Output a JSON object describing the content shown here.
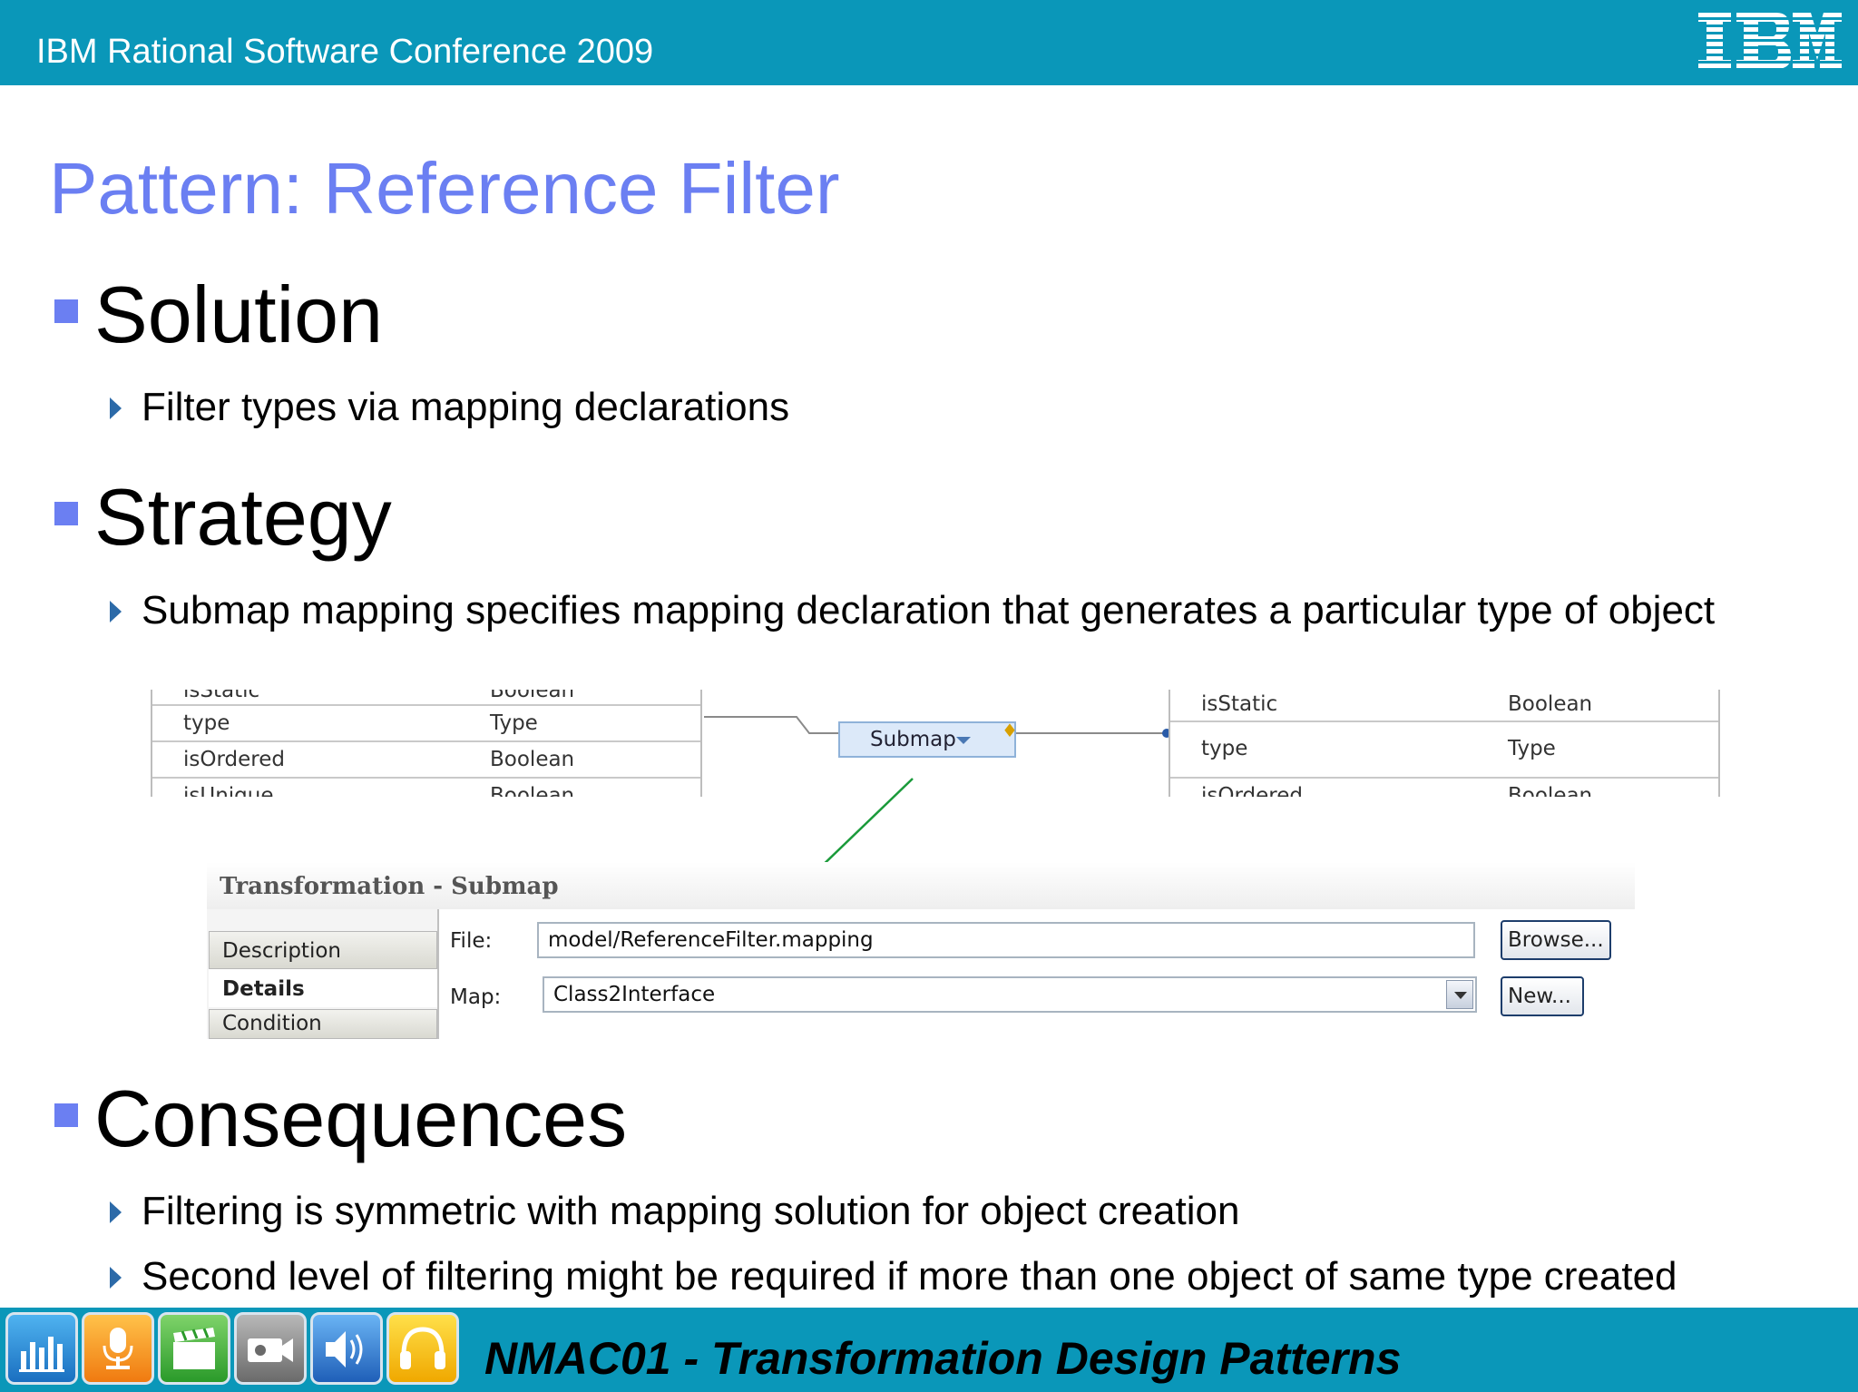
{
  "header": {
    "conference": "IBM Rational Software Conference 2009",
    "logo_text": "IBM"
  },
  "slide": {
    "title": "Pattern: Reference Filter",
    "sections": [
      {
        "heading": "Solution",
        "points": [
          "Filter types via mapping declarations"
        ]
      },
      {
        "heading": "Strategy",
        "points": [
          "Submap mapping specifies mapping declaration that generates a particular type of object"
        ]
      },
      {
        "heading": "Consequences",
        "points": [
          "Filtering is symmetric with mapping solution for object creation",
          "Second level of filtering might be required if more than one object of same type created"
        ]
      }
    ]
  },
  "diagram": {
    "left_table": [
      {
        "name": "isStatic",
        "type": "Boolean"
      },
      {
        "name": "type",
        "type": "Type"
      },
      {
        "name": "isOrdered",
        "type": "Boolean"
      },
      {
        "name": "isUnique",
        "type": "Boolean"
      }
    ],
    "submap_label": "Submap",
    "right_table": [
      {
        "name": "isStatic",
        "type": "Boolean"
      },
      {
        "name": "type",
        "type": "Type"
      },
      {
        "name": "isOrdered",
        "type": "Boolean"
      }
    ]
  },
  "properties": {
    "title": "Transformation - Submap",
    "tabs": [
      "Description",
      "Details",
      "Condition"
    ],
    "active_tab": "Details",
    "file_label": "File:",
    "file_value": "model/ReferenceFilter.mapping",
    "browse_label": "Browse...",
    "map_label": "Map:",
    "map_value": "Class2Interface",
    "new_label": "New..."
  },
  "footer": {
    "title": "NMAC01 - Transformation Design Patterns",
    "icons": [
      "chart-icon",
      "microphone-icon",
      "clapperboard-icon",
      "camera-icon",
      "speaker-icon",
      "headphones-icon"
    ]
  },
  "colors": {
    "banner": "#0a97b9",
    "title": "#6b7ff2",
    "bullet": "#6b7ff2",
    "arrow": "#1a9a3a"
  }
}
